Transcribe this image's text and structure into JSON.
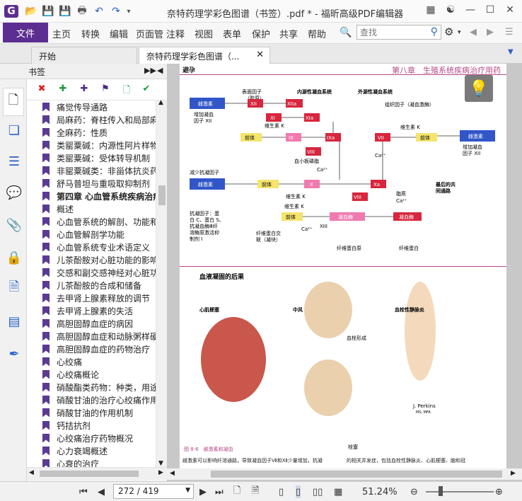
{
  "window": {
    "title": "奈特药理学彩色图谱（书签）.pdf * - 福昕高级PDF编辑器",
    "app_logo": "G"
  },
  "menubar": {
    "file": "文件",
    "items": [
      "主页",
      "转换",
      "编辑",
      "页面管",
      "注释",
      "视图",
      "表单",
      "保护",
      "共享",
      "帮助"
    ],
    "search_placeholder": "查找"
  },
  "tabs": [
    {
      "label": "开始"
    },
    {
      "label": "奈特药理学彩色图谱（..."
    }
  ],
  "sidebar": {
    "title": "书签",
    "bookmarks": [
      {
        "label": "痛觉传导通路",
        "bold": false
      },
      {
        "label": "局麻药：脊柱传入和局部麻醉",
        "bold": false
      },
      {
        "label": "全麻药：性质",
        "bold": false
      },
      {
        "label": "类罂粟碱：内源性阿片样物质",
        "bold": false
      },
      {
        "label": "类罂粟碱：受体转导机制",
        "bold": false
      },
      {
        "label": "非罂粟碱类：非甾体抗炎药",
        "bold": false
      },
      {
        "label": "舒马普坦与重吸取抑制剂",
        "bold": false
      },
      {
        "label": "第四章 心血管系统疾病治疗",
        "bold": true
      },
      {
        "label": "概述",
        "bold": false
      },
      {
        "label": "心血管系统的解剖、功能和调节",
        "bold": false
      },
      {
        "label": "心血管解剖学功能",
        "bold": false
      },
      {
        "label": "心血管系统专业术语定义",
        "bold": false
      },
      {
        "label": "儿茶酚胺对心脏功能的影响",
        "bold": false
      },
      {
        "label": "交感和副交感神经对心脏功能",
        "bold": false
      },
      {
        "label": "儿茶酚胺的合成和储备",
        "bold": false
      },
      {
        "label": "去甲肾上腺素释放的调节",
        "bold": false
      },
      {
        "label": "去甲肾上腺素的失活",
        "bold": false
      },
      {
        "label": "高胆固醇血症的病因",
        "bold": false
      },
      {
        "label": "高胆固醇血症和动脉粥样硬化",
        "bold": false
      },
      {
        "label": "高胆固醇血症的药物治疗",
        "bold": false
      },
      {
        "label": "心绞痛",
        "bold": false
      },
      {
        "label": "心绞痛概论",
        "bold": false
      },
      {
        "label": "硝酸酯类药物：种类，用途",
        "bold": false
      },
      {
        "label": "硝酸甘油的治疗心绞痛作用",
        "bold": false
      },
      {
        "label": "硝酸甘油的作用机制",
        "bold": false
      },
      {
        "label": "钙拮抗剂",
        "bold": false
      },
      {
        "label": "心绞痛治疗药物概况",
        "bold": false
      },
      {
        "label": "心力衰竭概述",
        "bold": false
      },
      {
        "label": "心衰的治疗",
        "bold": false
      }
    ]
  },
  "document": {
    "header_left": "避孕",
    "header_right": "第八章　生殖系统疾病治疗用药",
    "labels": {
      "intrinsic": "内源性凝血系统",
      "extrinsic": "外源性凝血系统",
      "surface": "表面因子",
      "collagen": "（胶原）",
      "tissue": "组织因子（凝血激酶）",
      "estrogen": "雌激素",
      "inc12": "增加凝血",
      "inc12b": "因子 XII",
      "vitk": "维生素 K",
      "pre": "前体",
      "plt": "血小板磷脂",
      "ca": "Ca²⁺",
      "common": "最后的共",
      "common2": "同通路",
      "dec": "减少抗凝因子",
      "fat": "脂质",
      "fibrin": "凝血酶",
      "fibrinogen": "纤维蛋白原",
      "fibrinfinal": "纤维蛋白",
      "fibrinx": "纤维蛋白交",
      "fibrinx2": "联（凝块）",
      "anti1": "抗凝因子：蛋",
      "anti2": "白 C、蛋白 S、",
      "anti3": "抗凝血酶Ⅲ纤",
      "anti4": "溶酶原激活抑",
      "anti5": "制剂 I",
      "f12": "XII",
      "f12a": "XIIa",
      "f11": "XI",
      "f11a": "XIa",
      "f9": "IX",
      "f9a": "IXa",
      "f8": "VIII",
      "f7": "VII",
      "f10": "X",
      "f10a": "Xa",
      "f13": "XIII",
      "sec2": "血液凝固的后果",
      "mi": "心肌梗塞",
      "stroke": "中风",
      "thrombo": "血栓形成",
      "embol": "栓塞",
      "dvt": "血栓性静脉炎",
      "sig": "J. Perkins",
      "sig2": "MS, MFA",
      "caption": "图 8-6　雌激素和凝血",
      "body1": "雌激素可以影响纤溶通路，导致凝血因子Ⅶ和Ⅻ少量增加，抗凝",
      "body2": "的相关并发症，包括血栓性静脉炎、心肌梗塞、脑和冠"
    }
  },
  "status": {
    "page_value": "272 / 419",
    "zoom": "51.24%"
  },
  "colors": {
    "accent": "#5c2e91",
    "blue_box": "#3056c8",
    "red_box": "#d7263d",
    "yellow_box": "#f4e46b",
    "pink_box": "#f07ab0"
  }
}
